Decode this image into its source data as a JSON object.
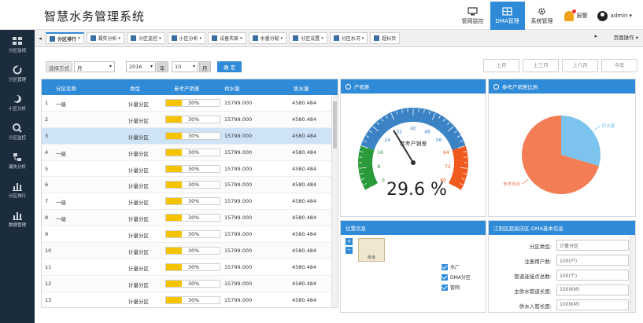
{
  "header": {
    "title": "智慧水务管理系统",
    "nav": [
      {
        "label": "管网监控",
        "icon": "monitor-icon",
        "active": false
      },
      {
        "label": "DMA管理",
        "icon": "grid-icon",
        "active": true
      },
      {
        "label": "系统管理",
        "icon": "gear-icon",
        "active": false
      }
    ],
    "alarm_label": "报警",
    "user_label": "admin"
  },
  "sidebar": {
    "items": [
      {
        "label": "分区监视",
        "icon": "dashboard-icon"
      },
      {
        "label": "分区管理",
        "icon": "refresh-icon"
      },
      {
        "label": "小区分析",
        "icon": "moon-icon"
      },
      {
        "label": "分区监控",
        "icon": "search-icon"
      },
      {
        "label": "漏失分析",
        "icon": "tree-icon"
      },
      {
        "label": "分区排行",
        "icon": "chart-bar-icon"
      },
      {
        "label": "数据管理",
        "icon": "chart-bar-icon"
      }
    ]
  },
  "tabs": {
    "items": [
      "分区排行",
      "漏失分析",
      "分区监控",
      "小区分析",
      "设备失联",
      "水量分配",
      "分区设置",
      "分区水况",
      "超标页"
    ],
    "active_index": 0,
    "more_label": "页面操作"
  },
  "filter": {
    "mode_label": "选择方式",
    "mode_value": "月",
    "year_value": "2016",
    "year_unit": "年",
    "month_value": "10",
    "month_unit": "月",
    "confirm_label": "确 定",
    "periods": [
      "上月",
      "上三月",
      "上六月",
      "今年"
    ]
  },
  "table": {
    "columns": [
      "分区名称",
      "类型",
      "参考产销差",
      "供水量",
      "售水量"
    ],
    "rows": [
      {
        "no": "1",
        "name": "一级",
        "type": "计量分区",
        "pct": 30,
        "pct_label": "30%",
        "supply": "15799.000",
        "sold": "4580.484",
        "selected": false
      },
      {
        "no": "2",
        "name": "",
        "type": "计量分区",
        "pct": 30,
        "pct_label": "30%",
        "supply": "15799.000",
        "sold": "4580.484",
        "selected": false
      },
      {
        "no": "3",
        "name": "",
        "type": "计量分区",
        "pct": 30,
        "pct_label": "30%",
        "supply": "15799.000",
        "sold": "4580.484",
        "selected": true
      },
      {
        "no": "4",
        "name": "一级",
        "type": "计量分区",
        "pct": 30,
        "pct_label": "30%",
        "supply": "15799.000",
        "sold": "4580.484",
        "selected": false
      },
      {
        "no": "5",
        "name": "",
        "type": "计量分区",
        "pct": 30,
        "pct_label": "30%",
        "supply": "15799.000",
        "sold": "4580.484",
        "selected": false
      },
      {
        "no": "6",
        "name": "",
        "type": "计量分区",
        "pct": 30,
        "pct_label": "30%",
        "supply": "15799.000",
        "sold": "4580.484",
        "selected": false
      },
      {
        "no": "7",
        "name": "一级",
        "type": "计量分区",
        "pct": 30,
        "pct_label": "30%",
        "supply": "15799.000",
        "sold": "4580.484",
        "selected": false
      },
      {
        "no": "8",
        "name": "一级",
        "type": "计量分区",
        "pct": 30,
        "pct_label": "30%",
        "supply": "15799.000",
        "sold": "4580.484",
        "selected": false
      },
      {
        "no": "9",
        "name": "",
        "type": "计量分区",
        "pct": 30,
        "pct_label": "30%",
        "supply": "15799.000",
        "sold": "4580.484",
        "selected": false
      },
      {
        "no": "10",
        "name": "",
        "type": "计量分区",
        "pct": 30,
        "pct_label": "30%",
        "supply": "15799.000",
        "sold": "4580.484",
        "selected": false
      },
      {
        "no": "11",
        "name": "",
        "type": "计量分区",
        "pct": 30,
        "pct_label": "30%",
        "supply": "15799.000",
        "sold": "4580.484",
        "selected": false
      },
      {
        "no": "12",
        "name": "",
        "type": "计量分区",
        "pct": 30,
        "pct_label": "30%",
        "supply": "15799.000",
        "sold": "4580.484",
        "selected": false
      },
      {
        "no": "13",
        "name": "",
        "type": "计量分区",
        "pct": 30,
        "pct_label": "30%",
        "supply": "15799.000",
        "sold": "4580.484",
        "selected": false
      }
    ]
  },
  "gauge_panel": {
    "title": "产销差",
    "center_label": "参考产销差",
    "value": 29.6,
    "value_label": "29.6 %",
    "ticks": [
      "0",
      "8",
      "16",
      "24",
      "32",
      "40",
      "48",
      "56",
      "64",
      "72",
      "80"
    ],
    "colors": {
      "low": "#2a9a3a",
      "mid": "#3b83c4",
      "high": "#f05a1e"
    }
  },
  "pie_panel": {
    "title": "参考产销差比例",
    "chart_data": {
      "type": "pie",
      "slices": [
        {
          "label": "供水量",
          "value": 29.6,
          "color": "#7cc3ee"
        },
        {
          "label": "参考用水",
          "value": 70.4,
          "color": "#f37d55"
        }
      ]
    }
  },
  "location_panel": {
    "title": "位置信息",
    "map_label": "街道",
    "zoom_in": "+",
    "zoom_out": "−",
    "layers": [
      "水厂",
      "DMA分区",
      "管网"
    ]
  },
  "info_panel": {
    "title": "江阳区超高压区-DMA基本信息",
    "rows": [
      {
        "label": "分区类型:",
        "value": "计量分区"
      },
      {
        "label": "注册用户数:",
        "value": "100(户)"
      },
      {
        "label": "管道连接点总数:",
        "value": "100(个)"
      },
      {
        "label": "主供水管道长度:",
        "value": "100(KM)"
      },
      {
        "label": "供水入管长度:",
        "value": "100(KM)"
      }
    ]
  }
}
